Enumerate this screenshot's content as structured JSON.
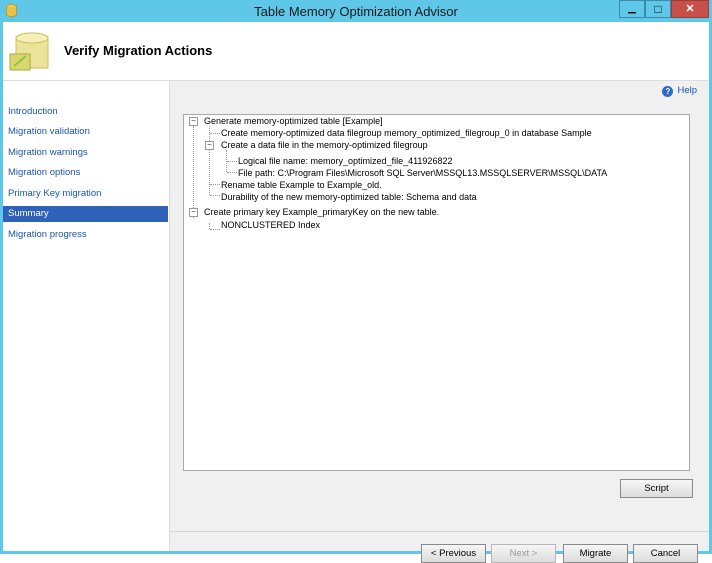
{
  "window": {
    "title": "Table Memory Optimization Advisor",
    "minimize_glyph": "▁",
    "maximize_glyph": "□",
    "close_glyph": "✕",
    "close_color": "#c7504b"
  },
  "header": {
    "title": "Verify Migration Actions"
  },
  "sidebar": {
    "items": [
      {
        "label": "Introduction"
      },
      {
        "label": "Migration validation"
      },
      {
        "label": "Migration warnings"
      },
      {
        "label": "Migration options"
      },
      {
        "label": "Primary Key migration"
      },
      {
        "label": "Summary",
        "selected": true
      },
      {
        "label": "Migration progress"
      }
    ]
  },
  "help": {
    "label": "Help",
    "icon": "help-icon"
  },
  "tree": {
    "lines": [
      "Generate memory-optimized table [Example]",
      "Create memory-optimized data filegroup memory_optimized_filegroup_0 in database Sample",
      "Create a data file in the memory-optimized filegroup",
      "Logical file name: memory_optimized_file_411926822",
      "File path: C:\\Program Files\\Microsoft SQL Server\\MSSQL13.MSSQLSERVER\\MSSQL\\DATA",
      "Rename table Example to Example_old.",
      "Durability of the new memory-optimized table: Schema and data",
      "Create primary key Example_primaryKey on the new table.",
      "NONCLUSTERED Index"
    ],
    "expander_glyph": "−"
  },
  "buttons": {
    "script": "Script",
    "previous": "< Previous",
    "next": "Next >",
    "migrate": "Migrate",
    "cancel": "Cancel"
  }
}
